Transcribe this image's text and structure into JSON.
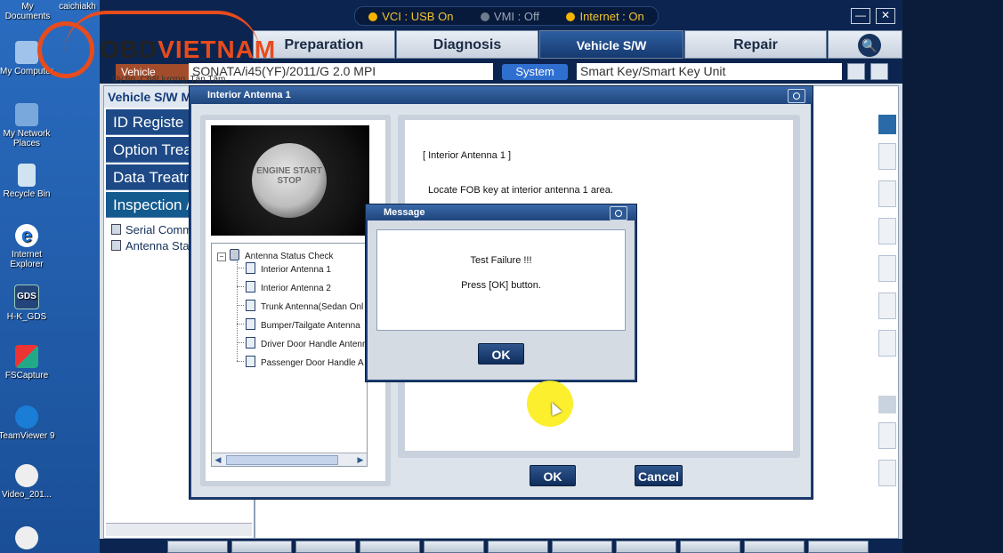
{
  "desktop": {
    "icons": [
      {
        "label": "My Documents",
        "icon": "folder-icon"
      },
      {
        "label": "caichiakh",
        "icon": "folder-icon"
      },
      {
        "label": "My Computer",
        "icon": "computer-icon"
      },
      {
        "label": "My Network Places",
        "icon": "network-icon"
      },
      {
        "label": "Recycle Bin",
        "icon": "recycle-bin-icon"
      },
      {
        "label": "Internet Explorer",
        "icon": "ie-icon"
      },
      {
        "label": "H-K_GDS",
        "icon": "gds-icon",
        "glyph": "GDS"
      },
      {
        "label": "FSCapture",
        "icon": "fscapture-icon"
      },
      {
        "label": "TeamViewer 9",
        "icon": "teamviewer-icon"
      },
      {
        "label": "Video_201...",
        "icon": "video-icon"
      }
    ]
  },
  "status": {
    "vci": "VCI : USB On",
    "vmi": "VMI : Off",
    "internet": "Internet : On"
  },
  "window_controls": {
    "minimize": "—",
    "close": "✕"
  },
  "nav": {
    "tabs": [
      "Preparation",
      "Diagnosis",
      "Vehicle S/W Management",
      "Repair"
    ],
    "active": "Vehicle S/W Management",
    "search_icon": "🔍"
  },
  "vehicle_row": {
    "vehicle_label": "Vehicle",
    "vehicle_value": "SONATA/i45(YF)/2011/G 2.0 MPI",
    "system_label": "System",
    "system_value": "Smart Key/Smart Key Unit"
  },
  "left_panel": {
    "title": "Vehicle S/W M",
    "items": [
      "ID Registe",
      "Option Treat",
      "Data Treatr",
      "Inspection /"
    ],
    "subitems": [
      "Serial Comm",
      "Antenna Stat"
    ]
  },
  "dialog": {
    "title": "Interior Antenna 1",
    "photo_text": "ENGINE START STOP",
    "tree": {
      "root": "Antenna Status Check",
      "children": [
        "Interior Antenna 1",
        "Interior Antenna 2",
        "Trunk Antenna(Sedan Onl",
        "Bumper/Tailgate Antenna",
        "Driver Door Handle Antenn",
        "Passenger Door Handle A"
      ]
    },
    "info_heading": "[ Interior Antenna 1 ]",
    "info_text": "Locate FOB key at interior antenna 1 area.",
    "ok": "OK",
    "cancel": "Cancel"
  },
  "message": {
    "title": "Message",
    "line1": "Test Failure !!!",
    "line2": "Press [OK] button.",
    "ok": "OK"
  },
  "watermark": {
    "brand_prefix": "OBD",
    "brand_suffix": "VIETNAM",
    "tagline": "Uy tín, Chất lượng, Tận Tâm"
  },
  "colors": {
    "accent": "#f2c230",
    "nav_active": "#1f4c8c",
    "dialog_frame": "#1c3f75"
  }
}
